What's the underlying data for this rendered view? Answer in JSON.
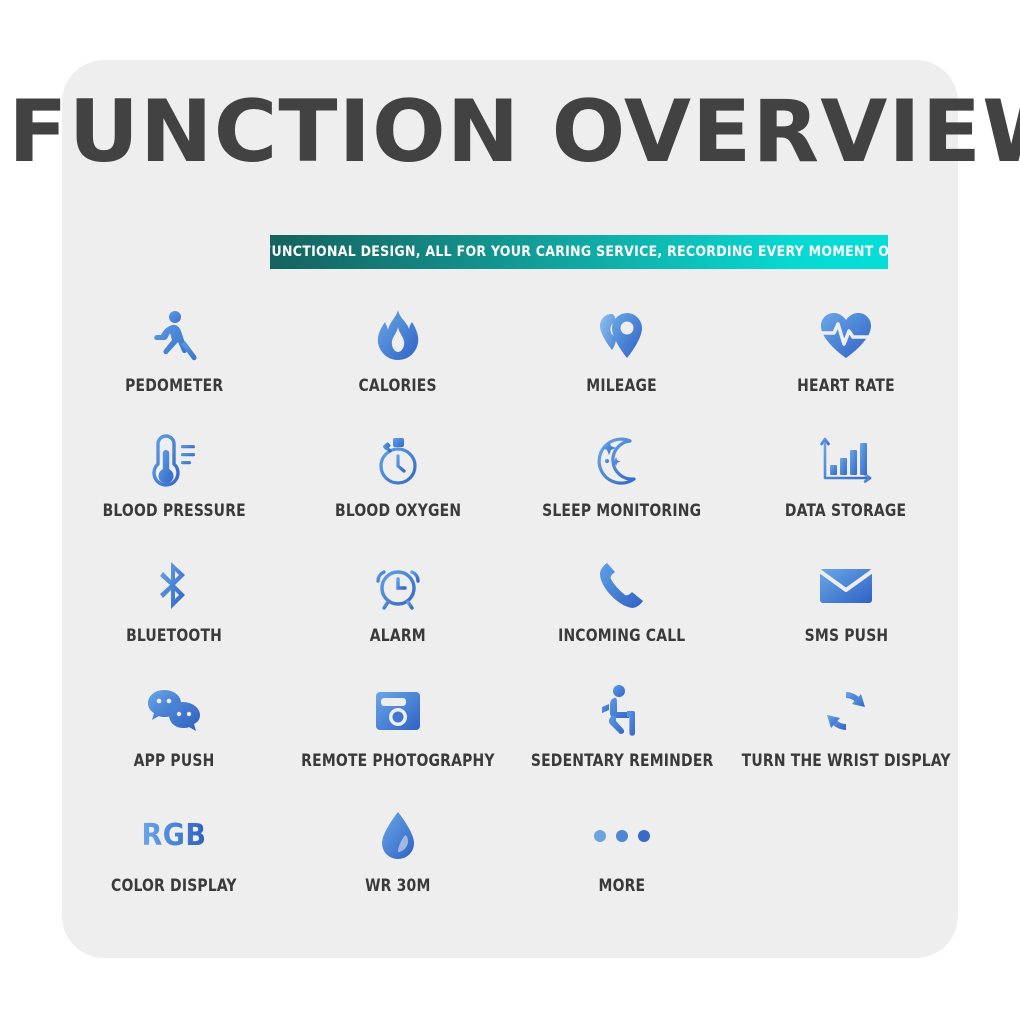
{
  "header": {
    "title": "FUNCTION OVERVIEW",
    "subtitle": "EACH FUNCTIONAL DESIGN, ALL FOR YOUR CARING SERVICE, RECORDING EVERY MOMENT OF LIFE.",
    "title_color": "#424242",
    "subtitle_gradient_from": "#15615e",
    "subtitle_gradient_to": "#05ded8"
  },
  "card": {
    "background": "#eeeeee",
    "page_background": "#ffffff"
  },
  "icon_color": "#4a86d8",
  "features": [
    [
      {
        "label": "PEDOMETER",
        "icon": "running-person-icon"
      },
      {
        "label": "CALORIES",
        "icon": "flame-icon"
      },
      {
        "label": "MILEAGE",
        "icon": "map-pin-icon"
      },
      {
        "label": "HEART RATE",
        "icon": "heart-pulse-icon"
      }
    ],
    [
      {
        "label": "BLOOD PRESSURE",
        "icon": "thermometer-icon"
      },
      {
        "label": "BLOOD OXYGEN",
        "icon": "stopwatch-icon"
      },
      {
        "label": "SLEEP MONITORING",
        "icon": "moon-stars-icon"
      },
      {
        "label": "DATA STORAGE",
        "icon": "bar-chart-icon"
      }
    ],
    [
      {
        "label": "BLUETOOTH",
        "icon": "bluetooth-icon"
      },
      {
        "label": "ALARM",
        "icon": "alarm-clock-icon"
      },
      {
        "label": "INCOMING CALL",
        "icon": "phone-handset-icon"
      },
      {
        "label": "SMS PUSH",
        "icon": "envelope-icon"
      }
    ],
    [
      {
        "label": "APP PUSH",
        "icon": "chat-bubbles-icon"
      },
      {
        "label": "REMOTE PHOTOGRAPHY",
        "icon": "camera-icon"
      },
      {
        "label": "SEDENTARY REMINDER",
        "icon": "seated-person-icon"
      },
      {
        "label": "TURN THE WRIST DISPLAY",
        "icon": "refresh-arrows-icon"
      }
    ],
    [
      {
        "label": "COLOR DISPLAY",
        "icon": "rgb-text-icon",
        "icon_text": "RGB"
      },
      {
        "label": "WR 30M",
        "icon": "water-drop-icon"
      },
      {
        "label": "MORE",
        "icon": "three-dots-icon"
      },
      {
        "label": "",
        "icon": ""
      }
    ]
  ]
}
